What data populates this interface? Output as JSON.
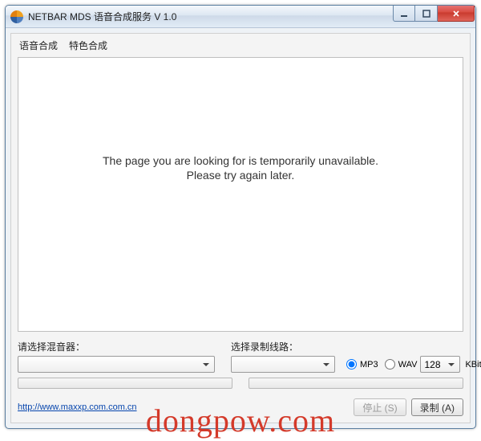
{
  "window": {
    "title": "NETBAR MDS 语音合成服务 V 1.0"
  },
  "menu": {
    "item1": "语音合成",
    "item2": "特色合成"
  },
  "content": {
    "line1": "The page you are looking for is temporarily unavailable.",
    "line2": "Please try again later."
  },
  "controls": {
    "mixer_label": "请选择混音器：",
    "mixer_value": "",
    "line_label": "选择录制线路：",
    "line_value": "",
    "format_mp3": "MP3",
    "format_wav": "WAV",
    "bitrate_value": "128",
    "bitrate_unit": "KBit/s"
  },
  "footer": {
    "link": "http://www.maxxp.com.com.cn",
    "stop_label": "停止 (S)",
    "record_label": "录制 (A)"
  },
  "watermark": "dongpow.com"
}
